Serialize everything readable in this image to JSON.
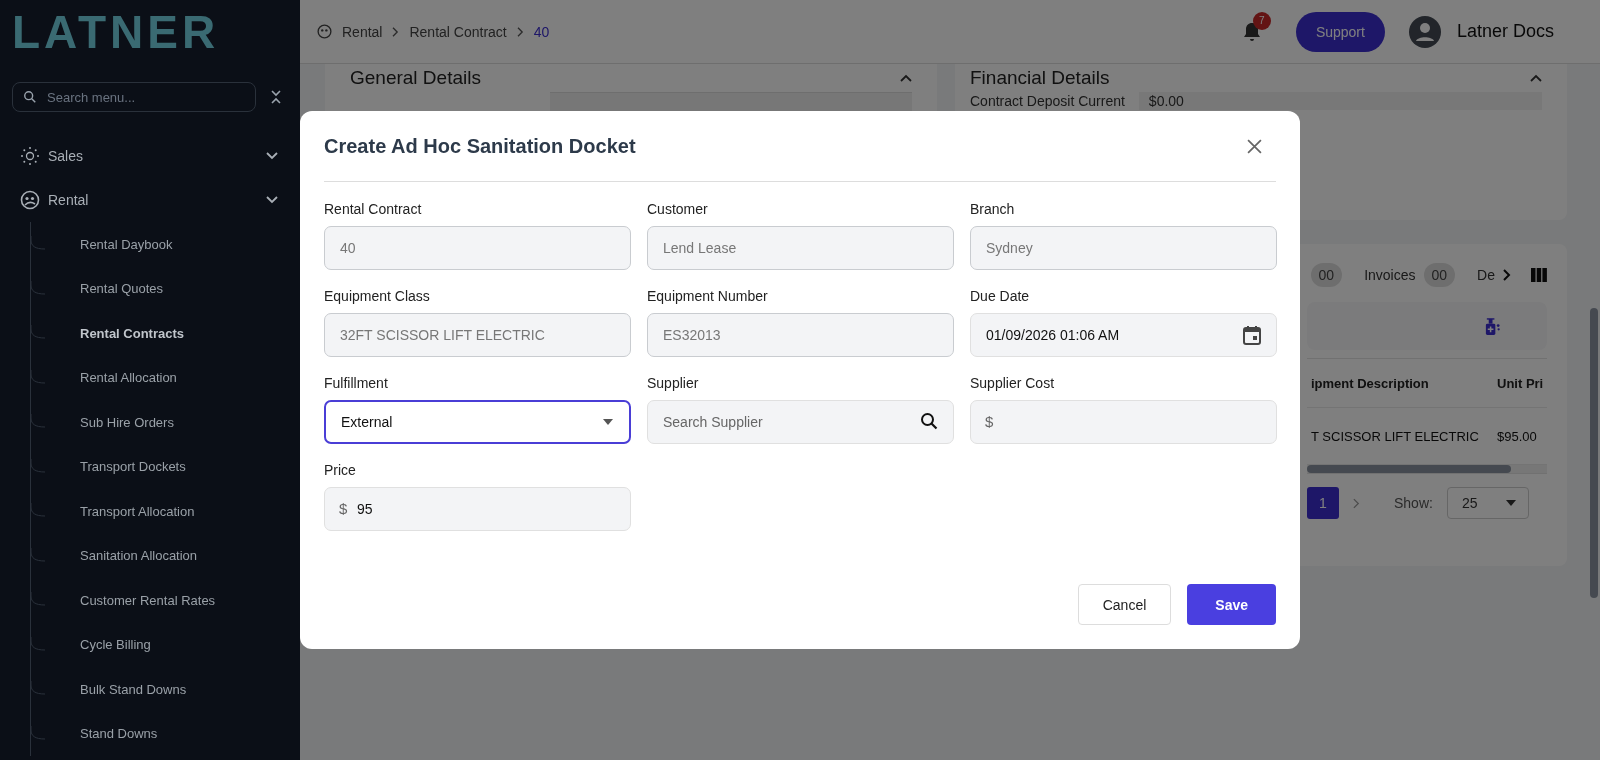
{
  "sidebar": {
    "logo": "LATNER",
    "search": {
      "placeholder": "Search menu..."
    },
    "items": [
      {
        "label": "Sales"
      },
      {
        "label": "Rental",
        "children": [
          {
            "label": "Rental Daybook",
            "selected": false
          },
          {
            "label": "Rental Quotes",
            "selected": false
          },
          {
            "label": "Rental Contracts",
            "selected": true
          },
          {
            "label": "Rental Allocation",
            "selected": false
          },
          {
            "label": "Sub Hire Orders",
            "selected": false
          },
          {
            "label": "Transport Dockets",
            "selected": false
          },
          {
            "label": "Transport Allocation",
            "selected": false
          },
          {
            "label": "Sanitation Allocation",
            "selected": false
          },
          {
            "label": "Customer Rental Rates",
            "selected": false
          },
          {
            "label": "Cycle Billing",
            "selected": false
          },
          {
            "label": "Bulk Stand Downs",
            "selected": false
          },
          {
            "label": "Stand Downs",
            "selected": false
          }
        ]
      }
    ]
  },
  "header": {
    "breadcrumbs": [
      {
        "label": "Rental",
        "current": false
      },
      {
        "label": "Rental Contract",
        "current": false
      },
      {
        "label": "40",
        "current": true
      }
    ],
    "notifications": "7",
    "support_button": "Support",
    "user": "Latner Docs"
  },
  "page": {
    "general_card": {
      "title": "General Details",
      "expanded": true
    },
    "financial_card": {
      "title": "Financial Details",
      "expanded": true,
      "field_label": "Contract Deposit Current",
      "field_value": "$0.00"
    },
    "tabs": [
      {
        "count": "00"
      },
      {
        "label": "Invoices",
        "count": "00"
      },
      {
        "label": "De"
      }
    ],
    "table": {
      "columns": [
        "ipment Description",
        "Unit Pri"
      ],
      "rows": [
        [
          "T SCISSOR LIFT ELECTRIC",
          "$95.00"
        ]
      ]
    },
    "pagination": {
      "pages": [
        {
          "label": "1",
          "selected": true
        }
      ],
      "show_label": "Show:",
      "page_size": "25"
    }
  },
  "modal": {
    "title": "Create Ad Hoc Sanitation Docket",
    "fields": [
      {
        "label": "Rental Contract",
        "kind": "text",
        "value": "40",
        "disabled": true,
        "focused": false
      },
      {
        "label": "Customer",
        "kind": "text",
        "value": "Lend Lease",
        "disabled": true,
        "focused": false
      },
      {
        "label": "Branch",
        "kind": "text",
        "value": "Sydney",
        "disabled": true,
        "focused": false
      },
      {
        "label": "Equipment Class",
        "kind": "text",
        "value": "32FT SCISSOR LIFT ELECTRIC",
        "disabled": true,
        "focused": false
      },
      {
        "label": "Equipment Number",
        "kind": "text",
        "value": "ES32013",
        "disabled": true,
        "focused": false
      },
      {
        "label": "Due Date",
        "kind": "date",
        "value": "01/09/2026 01:06 AM",
        "disabled": false,
        "focused": false
      },
      {
        "label": "Fulfillment",
        "kind": "select",
        "value": "External",
        "disabled": false,
        "focused": true
      },
      {
        "label": "Supplier",
        "kind": "search",
        "placeholder": "Search Supplier",
        "disabled": false,
        "focused": false
      },
      {
        "label": "Supplier Cost",
        "kind": "currency",
        "prefix": "$",
        "disabled": false,
        "focused": false
      },
      {
        "label": "Price",
        "kind": "currency",
        "prefix": "$",
        "value": "95",
        "disabled": false,
        "focused": false
      }
    ],
    "buttons": [
      {
        "label": "Cancel",
        "kind": "secondary"
      },
      {
        "label": "Save",
        "kind": "primary"
      }
    ]
  }
}
